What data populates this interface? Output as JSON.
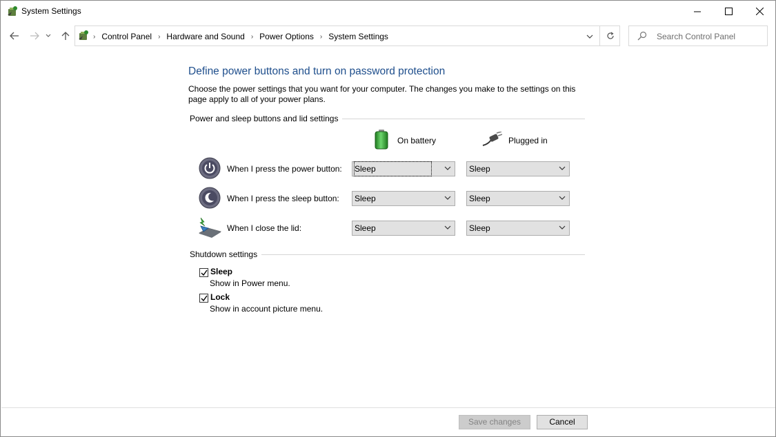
{
  "window": {
    "title": "System Settings"
  },
  "nav": {
    "breadcrumbs": [
      "Control Panel",
      "Hardware and Sound",
      "Power Options",
      "System Settings"
    ],
    "search_placeholder": "Search Control Panel"
  },
  "main": {
    "heading": "Define power buttons and turn on password protection",
    "description": "Choose the power settings that you want for your computer. The changes you make to the settings on this page apply to all of your power plans.",
    "power_group_label": "Power and sleep buttons and lid settings",
    "columns": {
      "on_battery": "On battery",
      "plugged_in": "Plugged in"
    },
    "rows": [
      {
        "label": "When I press the power button:",
        "on_battery": "Sleep",
        "plugged_in": "Sleep",
        "icon": "power-button-icon"
      },
      {
        "label": "When I press the sleep button:",
        "on_battery": "Sleep",
        "plugged_in": "Sleep",
        "icon": "sleep-button-icon"
      },
      {
        "label": "When I close the lid:",
        "on_battery": "Sleep",
        "plugged_in": "Sleep",
        "icon": "laptop-lid-icon"
      }
    ],
    "shutdown_group_label": "Shutdown settings",
    "shutdown": [
      {
        "title": "Sleep",
        "subtitle": "Show in Power menu.",
        "checked": true
      },
      {
        "title": "Lock",
        "subtitle": "Show in account picture menu.",
        "checked": true
      }
    ]
  },
  "footer": {
    "save_label": "Save changes",
    "cancel_label": "Cancel"
  },
  "colors": {
    "heading": "#1e4e8c",
    "battery_green": "#3aa53a"
  }
}
